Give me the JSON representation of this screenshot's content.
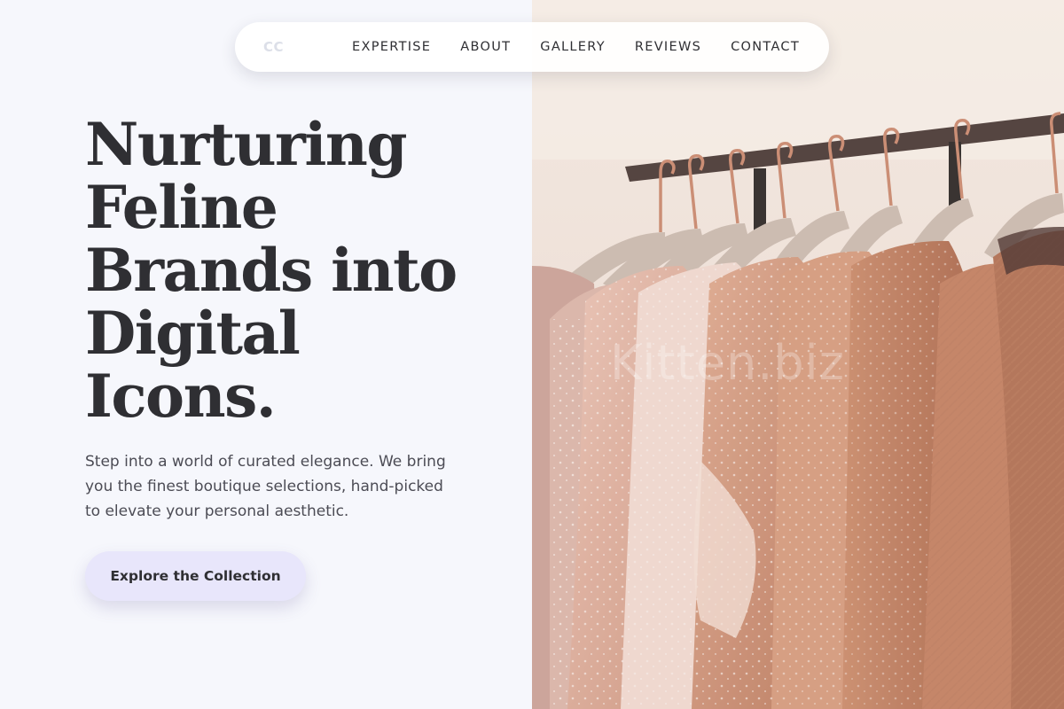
{
  "nav": {
    "logo": "CC",
    "links": [
      "EXPERTISE",
      "ABOUT",
      "GALLERY",
      "REVIEWS",
      "CONTACT"
    ]
  },
  "hero": {
    "title_lines": [
      "Nurturing",
      "Feline",
      "Brands into",
      "Digital",
      "Icons."
    ],
    "description": "Step into a world of curated elegance. We bring you the finest boutique selections, hand-picked to elevate your personal aesthetic.",
    "cta_label": "Explore the Collection"
  },
  "image": {
    "subject": "clothing-rack-photo",
    "watermark": "Kitten.biz"
  },
  "colors": {
    "background": "#f6f7fc",
    "text": "#2f2f33",
    "cta_background": "#e8e6fb",
    "logo": "#dcdfe8"
  }
}
